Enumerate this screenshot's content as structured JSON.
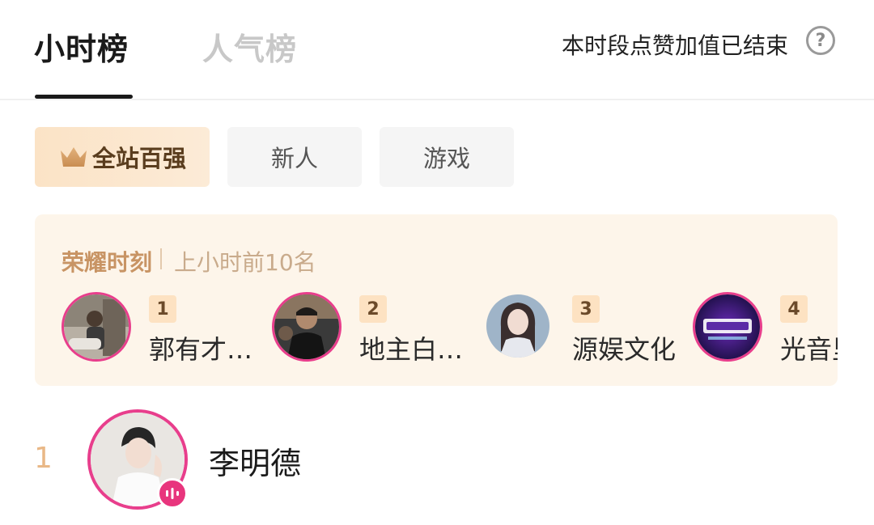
{
  "tabs": {
    "hourly": "小时榜",
    "popularity": "人气榜"
  },
  "status_text": "本时段点赞加值已结束",
  "help_glyph": "?",
  "chips": {
    "top100": "全站百强",
    "newcomer": "新人",
    "game": "游戏"
  },
  "glory": {
    "title": "荣耀时刻",
    "subtitle": "上小时前10名",
    "items": [
      {
        "rank": "1",
        "name": "郭有才…"
      },
      {
        "rank": "2",
        "name": "地主白…"
      },
      {
        "rank": "3",
        "name": "源娱文化"
      },
      {
        "rank": "4",
        "name": "光音里"
      }
    ]
  },
  "list": {
    "first": {
      "index": "1",
      "name": "李明德"
    }
  },
  "colors": {
    "accent_pink": "#e83e8c",
    "glory_bg": "#fdf5ea",
    "gold_text": "#c89464"
  },
  "icons": [
    "help-icon",
    "crown-icon",
    "live-audio-icon"
  ]
}
